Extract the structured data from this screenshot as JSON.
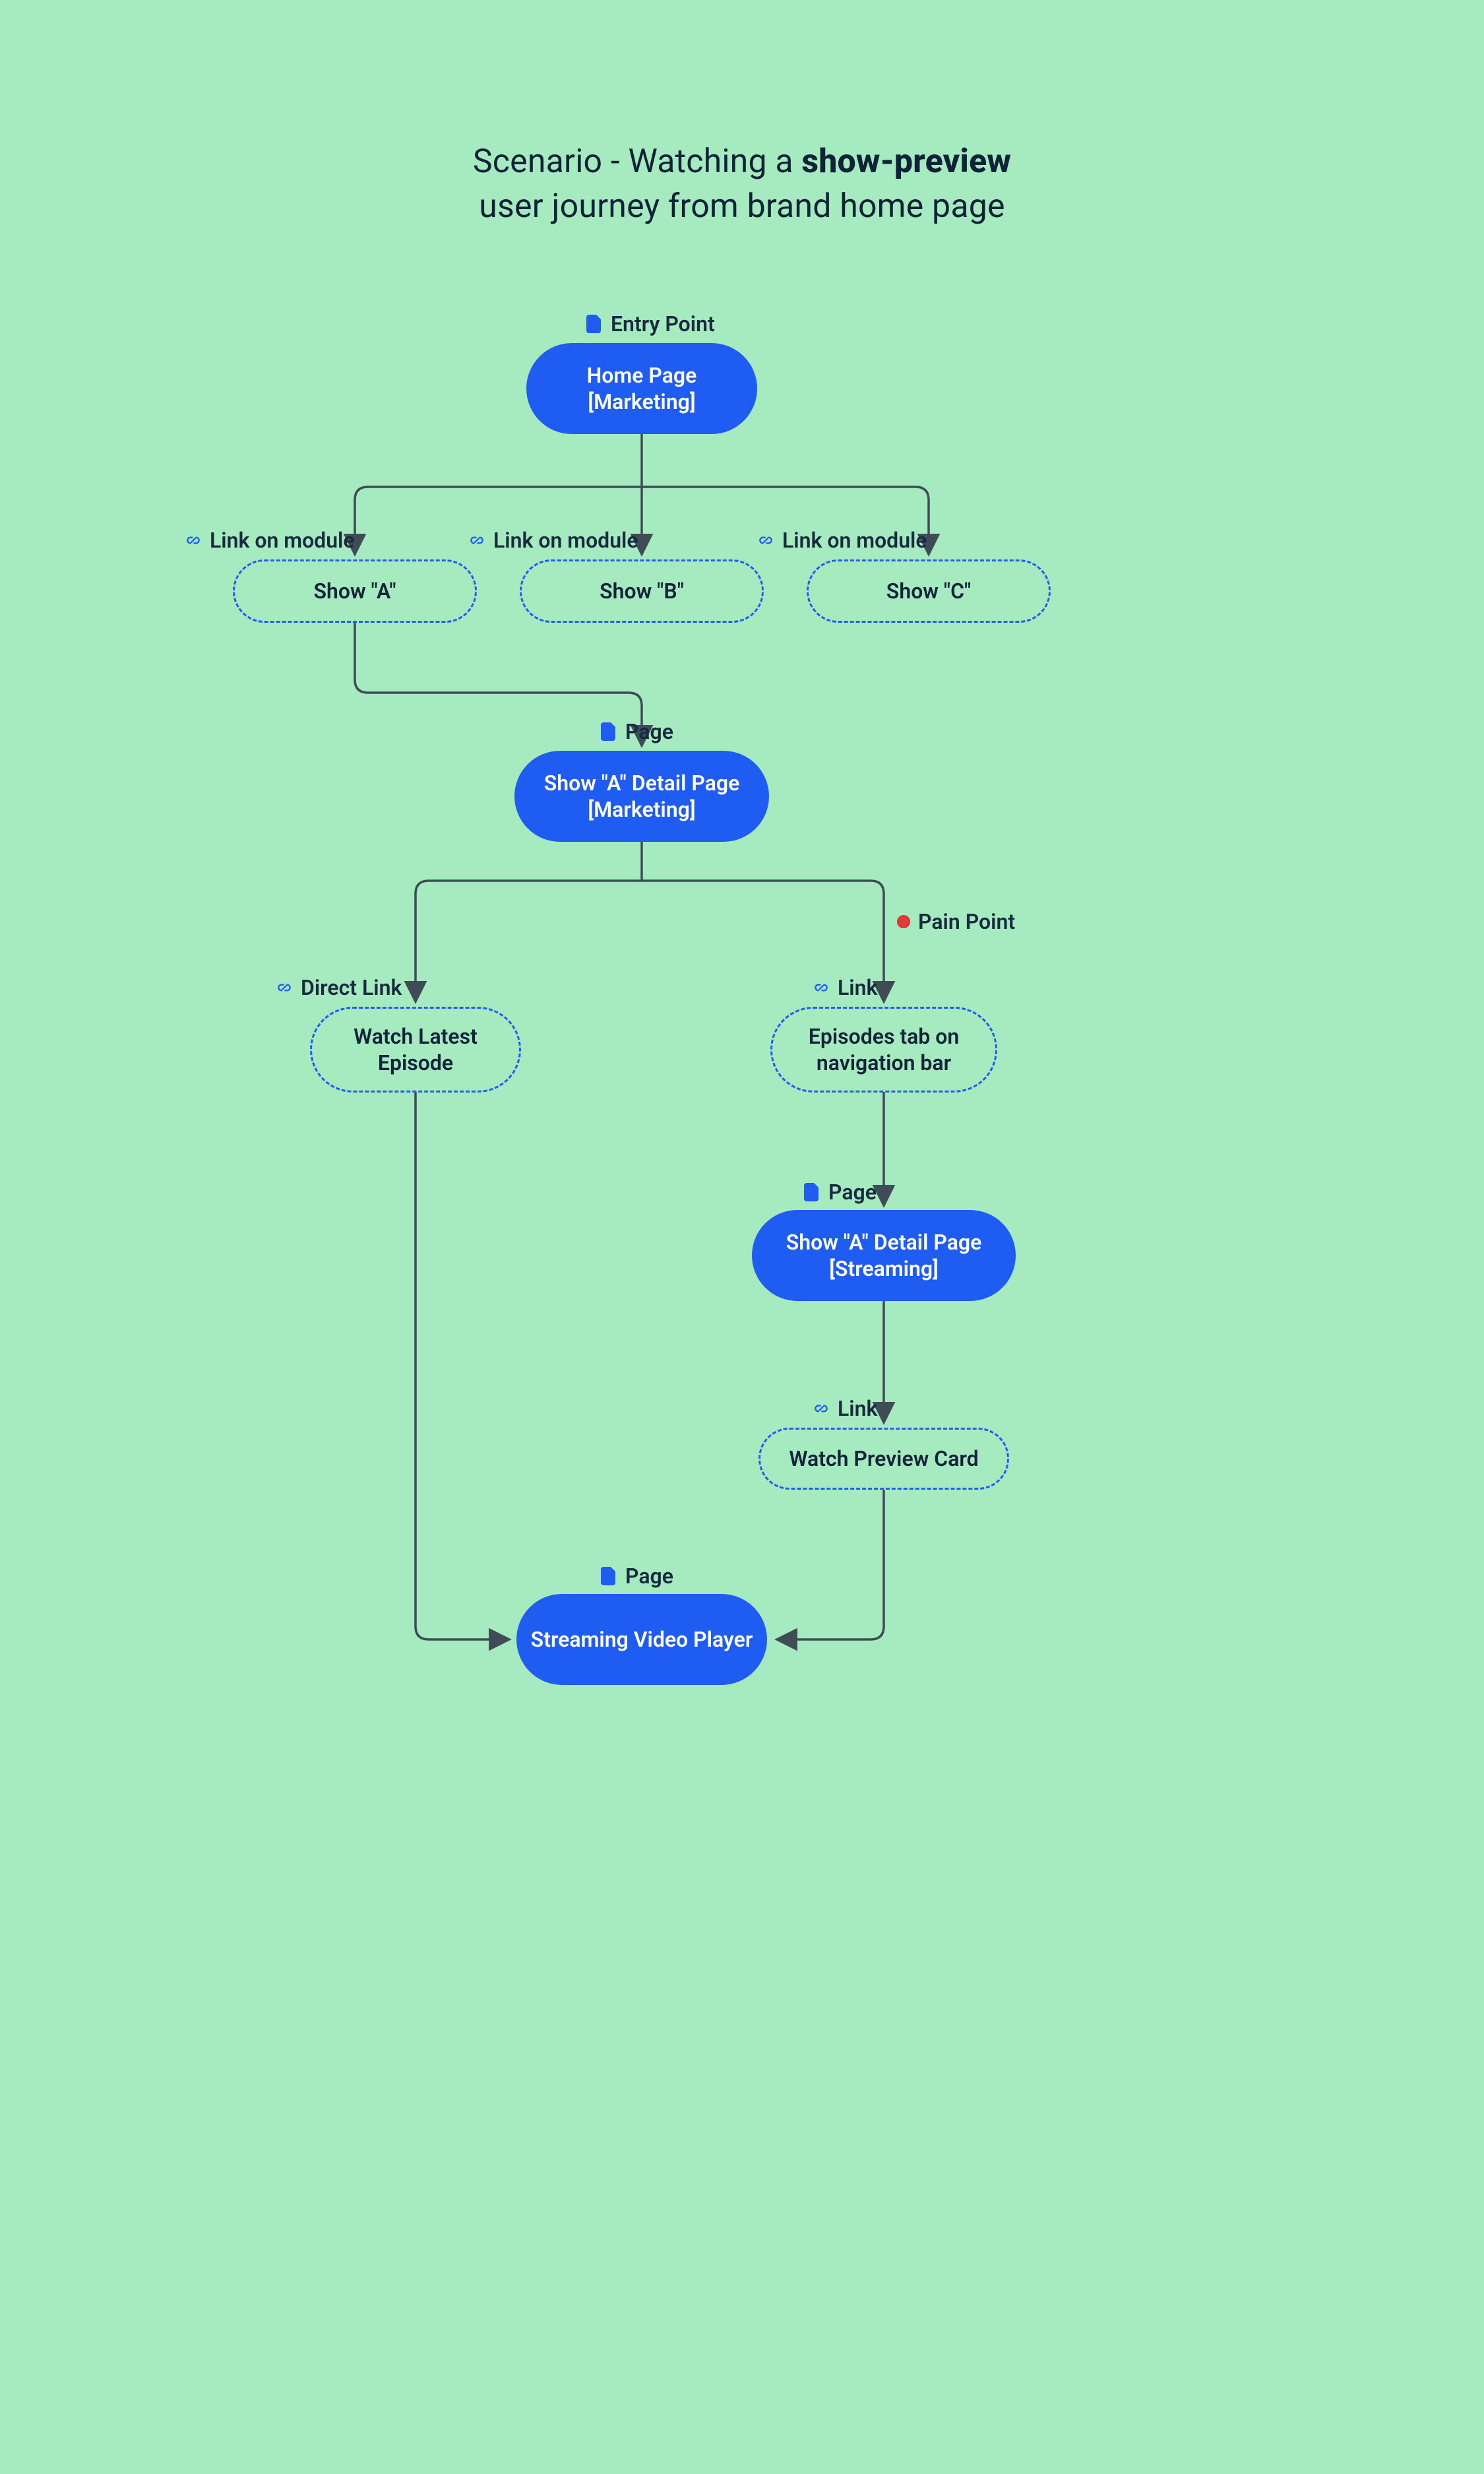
{
  "title": {
    "prefix": "Scenario - Watching a ",
    "bold": "show-preview",
    "line2": "user journey from brand home page"
  },
  "labels": {
    "entry": "Entry Point",
    "linkModuleA": "Link on module",
    "linkModuleB": "Link on module",
    "linkModuleC": "Link on module",
    "pageDetail": "Page",
    "painPoint": "Pain Point",
    "directLink": "Direct Link",
    "linkEpisodes": "Link",
    "pageStreaming": "Page",
    "linkPreview": "Link",
    "pagePlayer": "Page"
  },
  "nodes": {
    "home": "Home Page [Marketing]",
    "showA": "Show \"A\"",
    "showB": "Show \"B\"",
    "showC": "Show \"C\"",
    "detailMarketing": "Show \"A\" Detail Page [Marketing]",
    "watchLatest": "Watch Latest Episode",
    "episodesTab": "Episodes tab on navigation bar",
    "detailStreaming": "Show \"A\" Detail Page [Streaming]",
    "watchPreview": "Watch Preview Card",
    "player": "Streaming Video Player"
  },
  "colors": {
    "background": "#a6eac0",
    "primary": "#1f5df2",
    "text": "#12233a",
    "connector": "#3f4c56",
    "pain": "#e23b3b"
  }
}
